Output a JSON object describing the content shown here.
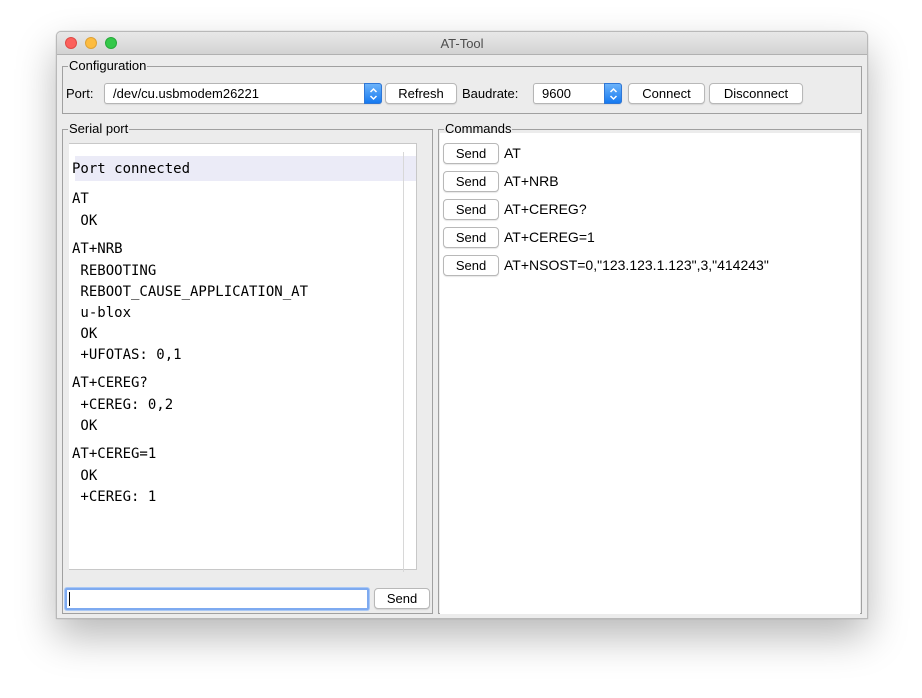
{
  "window": {
    "title": "AT-Tool"
  },
  "config": {
    "group_label": "Configuration",
    "port_label": "Port:",
    "port_value": "/dev/cu.usbmodem26221",
    "refresh_label": "Refresh",
    "baud_label": "Baudrate:",
    "baud_value": "9600",
    "connect_label": "Connect",
    "disconnect_label": "Disconnect"
  },
  "serial": {
    "group_label": "Serial port",
    "status": "Port connected",
    "log": [
      "AT",
      " OK",
      "AT+NRB",
      " REBOOTING",
      " REBOOT_CAUSE_APPLICATION_AT",
      " u-blox",
      " OK",
      " +UFOTAS: 0,1",
      "AT+CEREG?",
      " +CEREG: 0,2",
      " OK",
      "AT+CEREG=1",
      " OK",
      " +CEREG: 1"
    ],
    "input_value": "",
    "send_label": "Send"
  },
  "commands": {
    "group_label": "Commands",
    "items": [
      {
        "send_label": "Send",
        "command": "AT"
      },
      {
        "send_label": "Send",
        "command": "AT+NRB"
      },
      {
        "send_label": "Send",
        "command": "AT+CEREG?"
      },
      {
        "send_label": "Send",
        "command": "AT+CEREG=1"
      },
      {
        "send_label": "Send",
        "command": "AT+NSOST=0,\"123.123.1.123\",3,\"414243\""
      }
    ]
  },
  "colors": {
    "accent": "#1679f0",
    "focus_ring": "#7eaaf0",
    "status_bg": "#ebebf7"
  },
  "icons": [
    "close-icon",
    "minimize-icon",
    "zoom-icon",
    "chevron-updown-icon"
  ]
}
